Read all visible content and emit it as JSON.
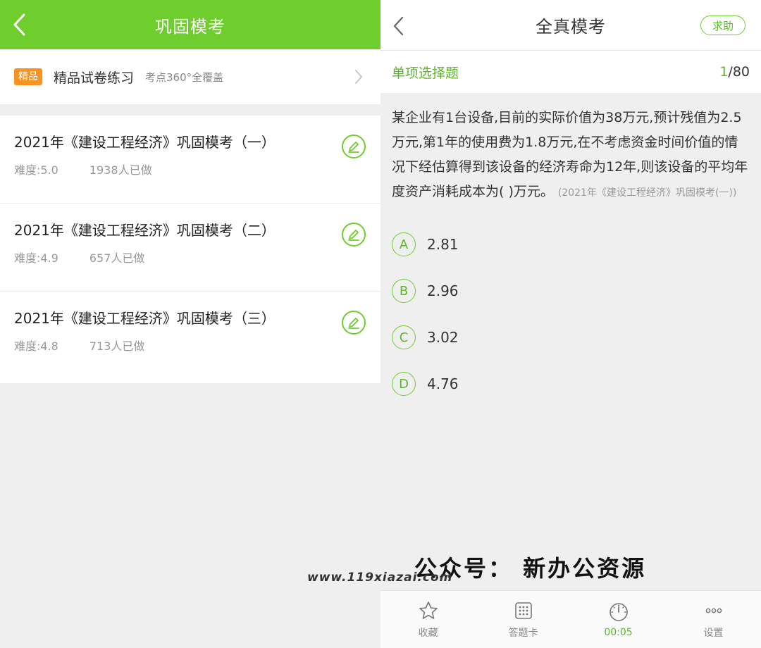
{
  "left": {
    "header": {
      "title": "巩固模考"
    },
    "promo": {
      "badge": "精品",
      "title": "精品试卷练习",
      "subtitle": "考点360°全覆盖"
    },
    "exams": [
      {
        "name": "2021年《建设工程经济》巩固模考（一）",
        "difficulty": "难度:5.0",
        "count": "1938人已做"
      },
      {
        "name": "2021年《建设工程经济》巩固模考（二）",
        "difficulty": "难度:4.9",
        "count": "657人已做"
      },
      {
        "name": "2021年《建设工程经济》巩固模考（三）",
        "difficulty": "难度:4.8",
        "count": "713人已做"
      }
    ]
  },
  "right": {
    "header": {
      "title": "全真模考",
      "help": "求助"
    },
    "question_type": "单项选择题",
    "progress": {
      "current": "1",
      "total": "/80"
    },
    "question": {
      "text": "某企业有1台设备,目前的实际价值为38万元,预计残值为2.5万元,第1年的使用费为1.8万元,在不考虑资金时间价值的情况下经估算得到该设备的经济寿命为12年,则该设备的平均年度资产消耗成本为( )万元。",
      "source": "(2021年《建设工程经济》巩固模考(一))"
    },
    "options": [
      {
        "letter": "A",
        "text": "2.81"
      },
      {
        "letter": "B",
        "text": "2.96"
      },
      {
        "letter": "C",
        "text": "3.02"
      },
      {
        "letter": "D",
        "text": "4.76"
      }
    ],
    "tabbar": [
      {
        "label": "收藏",
        "icon": "star-icon"
      },
      {
        "label": "答题卡",
        "icon": "grid-icon"
      },
      {
        "label": "00:05",
        "icon": "timer-icon"
      },
      {
        "label": "设置",
        "icon": "more-icon"
      }
    ]
  },
  "watermarks": {
    "wechat": "公众号：  新办公资源",
    "site": "www.119xiazai.com"
  },
  "colors": {
    "accent": "#6fcd2e",
    "badge": "#f7931e"
  }
}
